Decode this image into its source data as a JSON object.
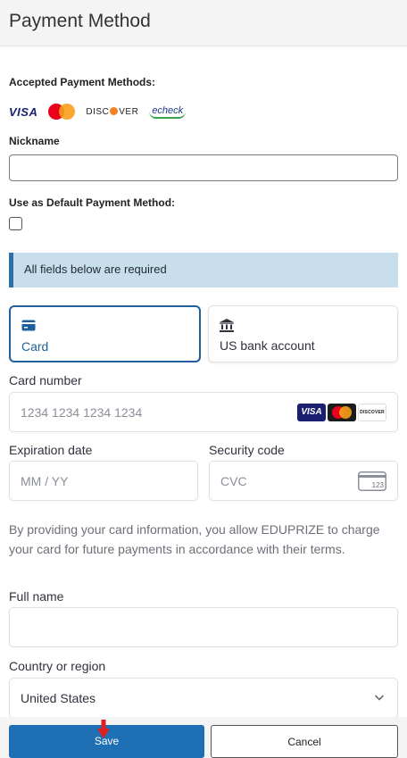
{
  "header": {
    "title": "Payment Method"
  },
  "accepted": {
    "label": "Accepted Payment Methods:",
    "brands": {
      "visa": "VISA",
      "discover_pre": "DISC",
      "discover_post": "VER",
      "echeck": "echeck"
    }
  },
  "nickname": {
    "label": "Nickname",
    "value": ""
  },
  "default_method": {
    "label": "Use as Default Payment Method:",
    "checked": false
  },
  "notice": {
    "text": "All fields below are required"
  },
  "tabs": [
    {
      "label": "Card",
      "icon": "card-icon",
      "selected": true
    },
    {
      "label": "US bank account",
      "icon": "bank-icon",
      "selected": false
    }
  ],
  "card_number": {
    "label": "Card number",
    "placeholder": "1234 1234 1234 1234",
    "brand_badges": {
      "visa": "VISA",
      "discover": "DISCOVER"
    }
  },
  "expiration": {
    "label": "Expiration date",
    "placeholder": "MM / YY"
  },
  "security": {
    "label": "Security code",
    "placeholder": "CVC",
    "icon_text": "123"
  },
  "terms": {
    "text": "By providing your card information, you allow EDUPRIZE to charge your card for future payments in accordance with their terms."
  },
  "full_name": {
    "label": "Full name",
    "value": ""
  },
  "country": {
    "label": "Country or region",
    "selected": "United States"
  },
  "buttons": {
    "save": "Save",
    "cancel": "Cancel"
  },
  "colors": {
    "accent": "#1f5f9b",
    "save_button": "#1f6fb5",
    "notice_bg": "#c9deed",
    "notice_bar": "#2f6fa8",
    "annotation_arrow": "#e02020"
  }
}
